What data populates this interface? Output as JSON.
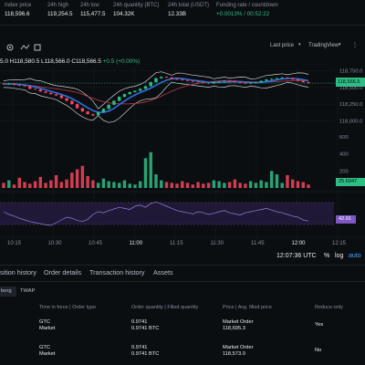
{
  "ticker": {
    "index_price": {
      "label": "Index price",
      "value": "118,596.6"
    },
    "high": {
      "label": "24h high",
      "value": "119,254.5"
    },
    "low": {
      "label": "24h low",
      "value": "115,477.5"
    },
    "qty": {
      "label": "24h quantity (BTC)",
      "value": "104.32K"
    },
    "total": {
      "label": "24h total (USDT)",
      "value": "12.33B"
    },
    "funding": {
      "label": "Funding rate / countdown",
      "value": "+0.0013% / 00:52:22"
    }
  },
  "toolbar": {
    "last_price": "Last price",
    "tradingview": "TradingView"
  },
  "legend": {
    "prefix": "5.0",
    "h": "H118,580.5",
    "l": "L118,566.0",
    "c": "C118,566.5",
    "change": "+0.5 (+0.00%)"
  },
  "price_tag": "118,566.5",
  "vol_tag": "25.6947",
  "rsi_tag": "42.91",
  "timebar": {
    "time": "12:07:36 UTC",
    "pct": "%",
    "log": "log",
    "auto": "auto"
  },
  "tabs": [
    "sition history",
    "Order details",
    "Transaction history",
    "Assets"
  ],
  "subtabs": [
    "berg",
    "TWAP"
  ],
  "table": {
    "headers": [
      "Time in force | Order type",
      "Order quantity | Filled quantity",
      "Price | Avg. filled price",
      "Reduce-only"
    ],
    "rows": [
      {
        "tif": "GTC",
        "type": "Market",
        "qty": "0.9741",
        "filled": "0.9741 BTC",
        "price": "Market Order",
        "avg": "118,695.3",
        "reduce": "Yes"
      },
      {
        "tif": "GTC",
        "type": "Market",
        "qty": "0.9741",
        "filled": "0.9741 BTC",
        "price": "Market Order",
        "avg": "118,573.0",
        "reduce": "No"
      }
    ]
  },
  "chart_data": {
    "type": "line",
    "price_ticks": [
      "118,750.0",
      "118,500.0",
      "118,250.0",
      "118,000.0"
    ],
    "price_ylim": [
      117950,
      118800
    ],
    "volume_ticks": [
      "600",
      "400",
      "200"
    ],
    "volume_ylim": [
      0,
      600
    ],
    "time_ticks": [
      "10:15",
      "10:30",
      "10:45",
      "11:00",
      "11:15",
      "11:30",
      "11:45",
      "12:00",
      "12:15"
    ],
    "x": [
      "10:10",
      "10:12",
      "10:14",
      "10:16",
      "10:18",
      "10:20",
      "10:22",
      "10:24",
      "10:26",
      "10:28",
      "10:30",
      "10:32",
      "10:34",
      "10:36",
      "10:38",
      "10:40",
      "10:42",
      "10:44",
      "10:46",
      "10:48",
      "10:50",
      "10:52",
      "10:54",
      "10:56",
      "10:58",
      "11:00",
      "11:02",
      "11:04",
      "11:06",
      "11:08",
      "11:10",
      "11:12",
      "11:14",
      "11:16",
      "11:18",
      "11:20",
      "11:22",
      "11:24",
      "11:26",
      "11:28",
      "11:30",
      "11:32",
      "11:34",
      "11:36",
      "11:38",
      "11:40",
      "11:42",
      "11:44",
      "11:46",
      "11:48",
      "11:50",
      "11:52",
      "11:54",
      "11:56",
      "11:58",
      "12:00",
      "12:02",
      "12:04",
      "12:06"
    ],
    "close": [
      118550,
      118560,
      118540,
      118530,
      118520,
      118480,
      118470,
      118440,
      118420,
      118400,
      118380,
      118340,
      118300,
      118250,
      118190,
      118140,
      118100,
      118080,
      118130,
      118180,
      118240,
      118300,
      118360,
      118400,
      118430,
      118450,
      118480,
      118520,
      118580,
      118640,
      118660,
      118650,
      118630,
      118620,
      118610,
      118600,
      118590,
      118580,
      118570,
      118560,
      118580,
      118590,
      118600,
      118590,
      118580,
      118570,
      118560,
      118570,
      118580,
      118600,
      118620,
      118630,
      118640,
      118650,
      118640,
      118620,
      118600,
      118580,
      118566
    ],
    "volume": [
      60,
      90,
      40,
      120,
      70,
      50,
      80,
      130,
      60,
      90,
      150,
      70,
      100,
      180,
      220,
      260,
      140,
      90,
      60,
      110,
      80,
      70,
      60,
      90,
      50,
      40,
      80,
      350,
      420,
      160,
      90,
      70,
      60,
      50,
      80,
      60,
      40,
      70,
      50,
      60,
      90,
      80,
      60,
      70,
      100,
      60,
      50,
      80,
      60,
      90,
      70,
      200,
      160,
      60,
      150,
      100,
      80,
      70,
      40
    ],
    "rsi": [
      60,
      55,
      52,
      48,
      45,
      42,
      40,
      38,
      36,
      35,
      40,
      45,
      50,
      48,
      44,
      42,
      46,
      55,
      60,
      58,
      62,
      65,
      68,
      66,
      64,
      70,
      72,
      68,
      75,
      78,
      74,
      70,
      66,
      62,
      60,
      58,
      56,
      60,
      58,
      55,
      57,
      60,
      62,
      58,
      56,
      54,
      58,
      60,
      62,
      64,
      66,
      63,
      60,
      58,
      55,
      52,
      50,
      45,
      43
    ]
  }
}
